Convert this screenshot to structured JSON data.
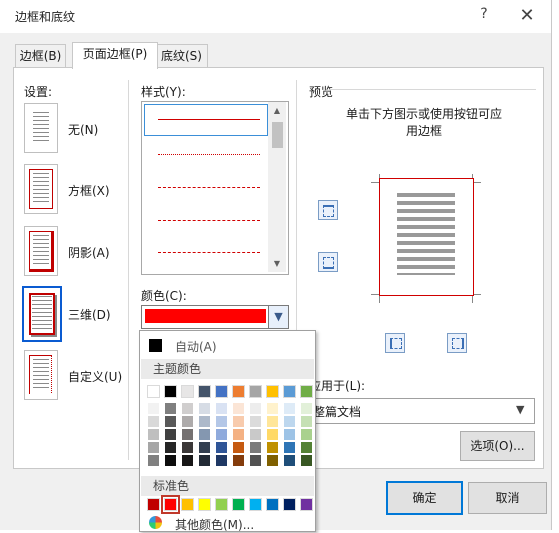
{
  "dialog": {
    "title": "边框和底纹",
    "help_label": "?",
    "close_label": "✕"
  },
  "tabs": [
    {
      "label": "边框(B)",
      "active": false
    },
    {
      "label": "页面边框(P)",
      "active": true
    },
    {
      "label": "底纹(S)",
      "active": false
    }
  ],
  "settings": {
    "label": "设置:",
    "items": [
      {
        "label": "无(N)",
        "type": "none"
      },
      {
        "label": "方框(X)",
        "type": "box"
      },
      {
        "label": "阴影(A)",
        "type": "shadow"
      },
      {
        "label": "三维(D)",
        "type": "3d",
        "selected": true
      },
      {
        "label": "自定义(U)",
        "type": "custom"
      }
    ]
  },
  "style": {
    "label": "样式(Y):",
    "options": [
      "solid",
      "dotted",
      "dash-small",
      "dash-large",
      "dash-dot",
      "dash-dot-dot"
    ]
  },
  "color": {
    "label": "颜色(C):",
    "selected_color": "#ff0000"
  },
  "preview": {
    "label": "预览",
    "instructions": "单击下方图示或使用按钮可应用边框"
  },
  "apply": {
    "label": "应用于(L):",
    "value": "整篇文档"
  },
  "options_button": "选项(O)...",
  "ok_button": "确定",
  "cancel_button": "取消",
  "color_popup": {
    "auto_label": "自动(A)",
    "theme_label": "主题颜色",
    "standard_label": "标准色",
    "more_label": "其他颜色(M)...",
    "theme_colors": [
      "#ffffff",
      "#000000",
      "#e7e6e6",
      "#44546a",
      "#4472c4",
      "#ed7d31",
      "#a5a5a5",
      "#ffc000",
      "#5b9bd5",
      "#70ad47"
    ],
    "theme_shades": [
      [
        "#f2f2f2",
        "#7f7f7f",
        "#d0cece",
        "#d6dce5",
        "#d9e2f3",
        "#fbe5d6",
        "#ededed",
        "#fff2cc",
        "#deebf7",
        "#e2f0d9"
      ],
      [
        "#d9d9d9",
        "#595959",
        "#aeabab",
        "#adb9ca",
        "#b4c7e7",
        "#f8cbad",
        "#dbdbdb",
        "#ffe699",
        "#bdd7ee",
        "#c5e0b4"
      ],
      [
        "#bfbfbf",
        "#404040",
        "#757171",
        "#8497b0",
        "#8faadc",
        "#f4b183",
        "#c9c9c9",
        "#ffd966",
        "#9dc3e6",
        "#a9d18e"
      ],
      [
        "#a6a6a6",
        "#262626",
        "#3b3838",
        "#333f50",
        "#2f5597",
        "#c55a11",
        "#7b7b7b",
        "#bf9000",
        "#2e75b6",
        "#548235"
      ],
      [
        "#808080",
        "#0d0d0d",
        "#171616",
        "#222a35",
        "#1f3864",
        "#843c0c",
        "#525252",
        "#7f6000",
        "#1f4e79",
        "#385723"
      ]
    ],
    "standard_colors": [
      "#c00000",
      "#ff0000",
      "#ffc000",
      "#ffff00",
      "#92d050",
      "#00b050",
      "#00b0f0",
      "#0070c0",
      "#002060",
      "#7030a0"
    ]
  }
}
